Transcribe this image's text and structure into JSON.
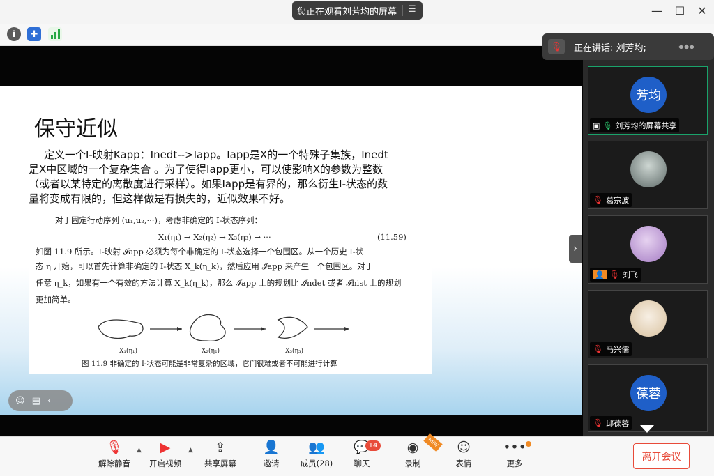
{
  "titlebar": {
    "viewing_text": "您正在观看刘芳均的屏幕",
    "menu_icon": "list-icon",
    "minimize": "—",
    "maximize": "☐",
    "close": "✕"
  },
  "speaking": {
    "text": "正在讲话: 刘芳均;"
  },
  "slide": {
    "title": "保守近似",
    "body": "定义一个I-映射Kapp：Inedt-->Iapp。Iapp是X的一个特殊子集族，Inedt是X中区域的一个复杂集合 。为了使得Iapp更小，可以使影响X的参数为整数（或者以某特定的离散度进行采样）。如果Iapp是有界的，那么衍生I-状态的数量将变成有限的，但这样做是有损失的，近似效果不好。",
    "book": {
      "line1": "对于固定行动序列 (u₁,u₂,···)，考虑非确定的 I-状态序列：",
      "equation": "X₁(η₁) → X₂(η₂) → X₃(η₃) → ···",
      "eq_number": "(11.59)",
      "line2": "如图 11.9 所示。I-映射 𝓘app 必须为每个非确定的 I-状态选择一个包围区。从一个历史 I-状",
      "line3": "态 η 开始，可以首先计算非确定的 I-状态 X_k(η_k)，然后应用 𝓘app 来产生一个包围区。对于",
      "line4": "任意 η_k，如果有一个有效的方法计算 X_k(η_k)，那么 𝓘app 上的规划比 𝓘ndet 或者 𝓘hist 上的规划",
      "line5": "更加简单。",
      "fig_labels": [
        "X₁(η₁)",
        "X₂(η₂)",
        "X₃(η₃)"
      ],
      "caption": "图 11.9  非确定的 I-状态可能是非常复杂的区域，它们很难或者不可能进行计算"
    }
  },
  "participants": [
    {
      "name": "刘芳均的屏幕共享",
      "avatar_text": "芳均",
      "color": "#1f5fc8",
      "active": true
    },
    {
      "name": "葛宗波",
      "avatar_text": "",
      "color": "#7d8a88",
      "active": false
    },
    {
      "name": "刘飞",
      "avatar_text": "",
      "color": "#b48bd0",
      "active": false
    },
    {
      "name": "马兴儒",
      "avatar_text": "",
      "color": "#e8d9c2",
      "active": false
    },
    {
      "name": "邱葆蓉",
      "avatar_text": "葆蓉",
      "color": "#1f5fc8",
      "active": false
    }
  ],
  "toolbar": {
    "unmute": "解除静音",
    "start_video": "开启视频",
    "share_screen": "共享屏幕",
    "invite": "邀请",
    "members": "成员(28)",
    "chat": "聊天",
    "chat_badge": "14",
    "record": "录制",
    "new_tag": "NEW",
    "emoji": "表情",
    "more": "更多",
    "leave": "离开会议"
  }
}
